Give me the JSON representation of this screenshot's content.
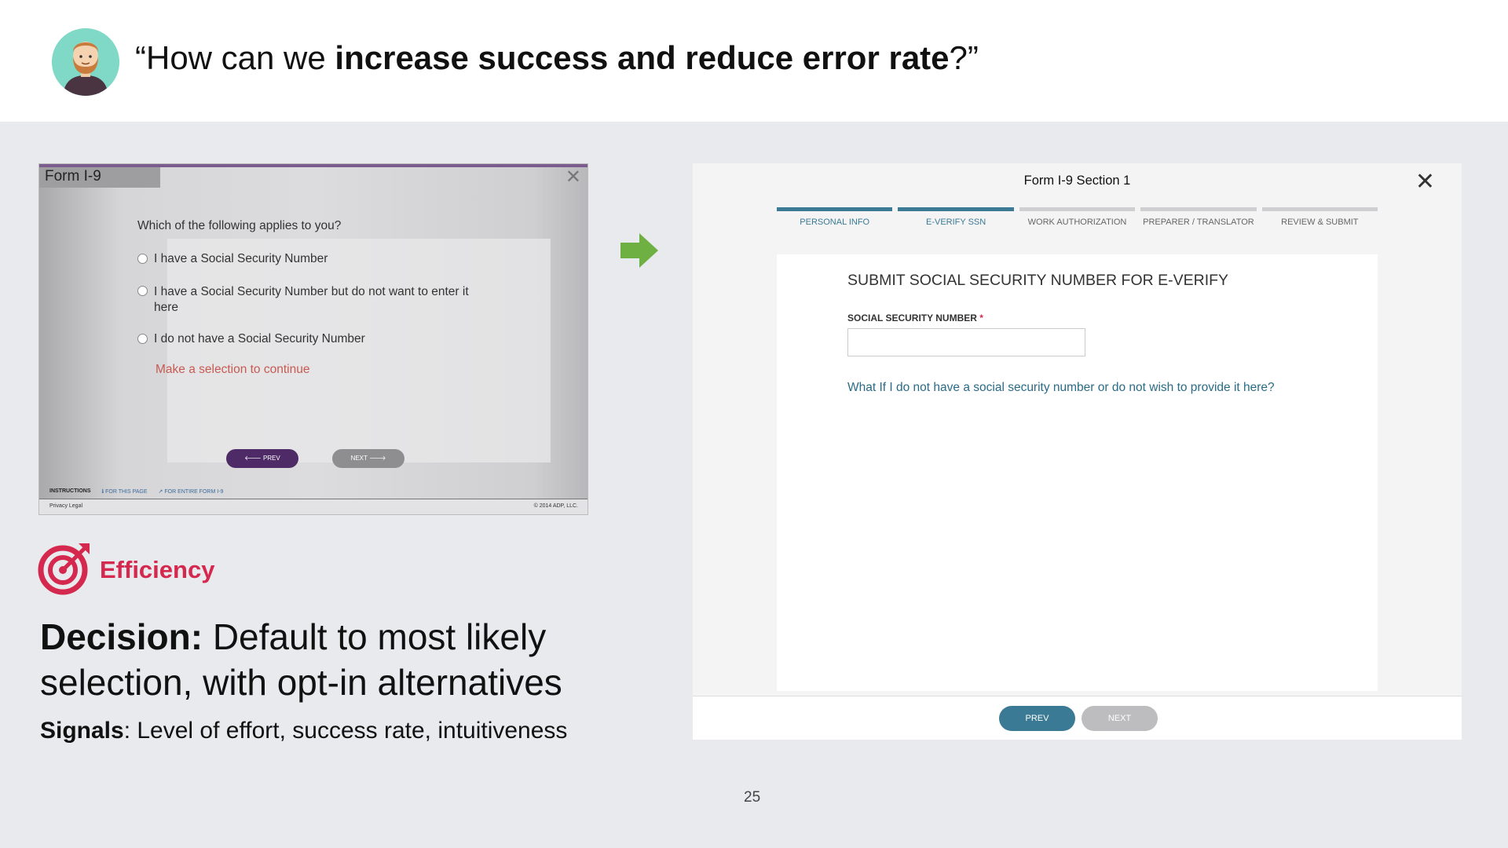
{
  "header": {
    "quote_open": "“How can we ",
    "quote_bold": "increase success and reduce error rate",
    "quote_close": "?”"
  },
  "old_form": {
    "title": "Form I-9",
    "question": "Which of the following applies to you?",
    "options": [
      "I have a Social Security Number",
      "I have a Social Security Number but do not want to enter it here",
      "I do not have a Social Security Number"
    ],
    "error": "Make a selection to continue",
    "prev_label": "🡐 PREV",
    "next_label": "NEXT 🡒",
    "instructions_label": "INSTRUCTIONS",
    "for_this_page": "FOR THIS PAGE",
    "for_entire_form": "FOR ENTIRE FORM I-9",
    "footer_left": "Privacy   Legal",
    "footer_right": "© 2014 ADP, LLC.",
    "colors": {
      "prev_button": "#4e2a66",
      "next_button": "#8e8e90",
      "error": "#c65a52"
    }
  },
  "efficiency_label": "Efficiency",
  "decision": {
    "bold": "Decision:",
    "text": " Default to most likely selection, with opt-in alternatives"
  },
  "signals": {
    "bold": "Signals",
    "text": ": Level of effort, success rate, intuitiveness"
  },
  "page_number": "25",
  "new_form": {
    "title": "Form I-9 Section 1",
    "steps": [
      {
        "label": "PERSONAL INFO",
        "done": true
      },
      {
        "label": "E-VERIFY SSN",
        "done": true
      },
      {
        "label": "WORK AUTHORIZATION",
        "done": false
      },
      {
        "label": "PREPARER / TRANSLATOR",
        "done": false
      },
      {
        "label": "REVIEW & SUBMIT",
        "done": false
      }
    ],
    "heading": "SUBMIT SOCIAL SECURITY NUMBER FOR E-VERIFY",
    "field_label": "SOCIAL SECURITY NUMBER",
    "required_mark": "*",
    "ssn_value": "",
    "help_link": "What If I do not have a social security number or do not wish to provide it here?",
    "prev_label": "PREV",
    "next_label": "NEXT",
    "colors": {
      "accent": "#3a7a95",
      "next_button": "#bdbdbf",
      "required": "#d4284e"
    }
  },
  "icons": {
    "close": "close-icon",
    "arrow": "arrow-right-icon",
    "target": "target-icon",
    "avatar": "avatar"
  }
}
